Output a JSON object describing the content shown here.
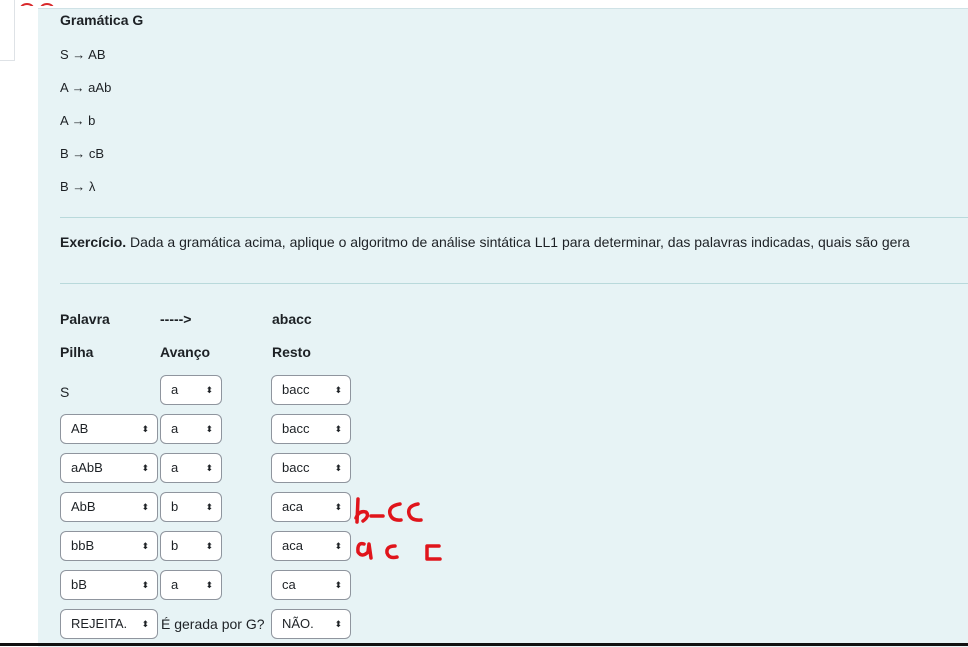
{
  "grammar": {
    "title": "Gramática G",
    "rules": [
      "S → AB",
      "A → aAb",
      "A → b",
      "B → cB",
      "B → λ"
    ]
  },
  "exercise": {
    "bold": "Exercício.",
    "text": " Dada a gramática acima, aplique o algoritmo de análise sintática LL1 para determinar, das palavras indicadas, quais são gera"
  },
  "table": {
    "word_label": "Palavra",
    "arrow": "----->",
    "word": "abacc",
    "col_pilha": "Pilha",
    "col_avanco": "Avanço",
    "col_resto": "Resto",
    "rows": [
      {
        "pilha": "S",
        "pilha_static": true,
        "avanco": "a",
        "resto": "bacc"
      },
      {
        "pilha": "AB",
        "avanco": "a",
        "resto": "bacc"
      },
      {
        "pilha": "aAbB",
        "avanco": "a",
        "resto": "bacc"
      },
      {
        "pilha": "AbB",
        "avanco": "b",
        "resto": "aca"
      },
      {
        "pilha": "bbB",
        "avanco": "b",
        "resto": "aca"
      },
      {
        "pilha": "bB",
        "avanco": "a",
        "resto": "ca"
      }
    ],
    "final": {
      "result": "REJEITA.",
      "question": "É gerada por G?",
      "answer": "NÃO."
    }
  },
  "colors": {
    "panel_bg": "#e7f3f5",
    "annotation": "#e0141b"
  }
}
